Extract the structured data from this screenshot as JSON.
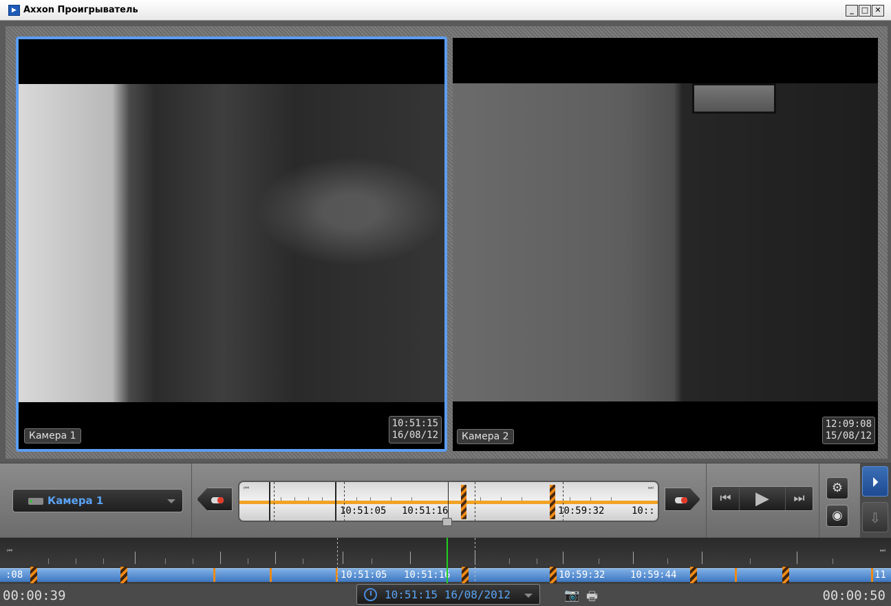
{
  "window": {
    "title": "Axxon Проигрыватель",
    "app_icon": "player-icon",
    "minimize": "_",
    "maximize": "□",
    "close": "✕"
  },
  "cameras": [
    {
      "label": "Камера 1",
      "time": "10:51:15",
      "date": "16/08/12",
      "selected": true
    },
    {
      "label": "Камера 2",
      "time": "12:09:08",
      "date": "15/08/12",
      "selected": false
    }
  ],
  "camera_selector": {
    "value": "Камера 1",
    "icon": "camera-icon"
  },
  "mini_timeline": {
    "labels": [
      "10:51:05",
      "10:51:16",
      "10:59:32",
      "10::"
    ]
  },
  "transport": {
    "prev": "⏮",
    "play": "▶",
    "next": "⏭"
  },
  "tool_buttons": {
    "settings_icon": "gear-icon",
    "view_icon": "eye-icon",
    "play_mode_icon": "play-circle-icon",
    "export_icon": "export-icon"
  },
  "timeline": {
    "left_edge": ":08",
    "right_edge": "11",
    "labels": [
      "10:51:05",
      "10:51:16",
      "10:59:32",
      "10:59:44"
    ]
  },
  "status": {
    "elapsed_left": "00:00:39",
    "elapsed_right": "00:00:50",
    "datetime": "10:51:15 16/08/2012",
    "camera_icon": "snapshot-icon",
    "print_icon": "print-icon"
  },
  "colors": {
    "accent": "#5aa3f5",
    "selection": "#5b9df3",
    "marker": "#f08a14",
    "cursor": "#1fd21f",
    "timeline_blue": "#3d76c0"
  }
}
